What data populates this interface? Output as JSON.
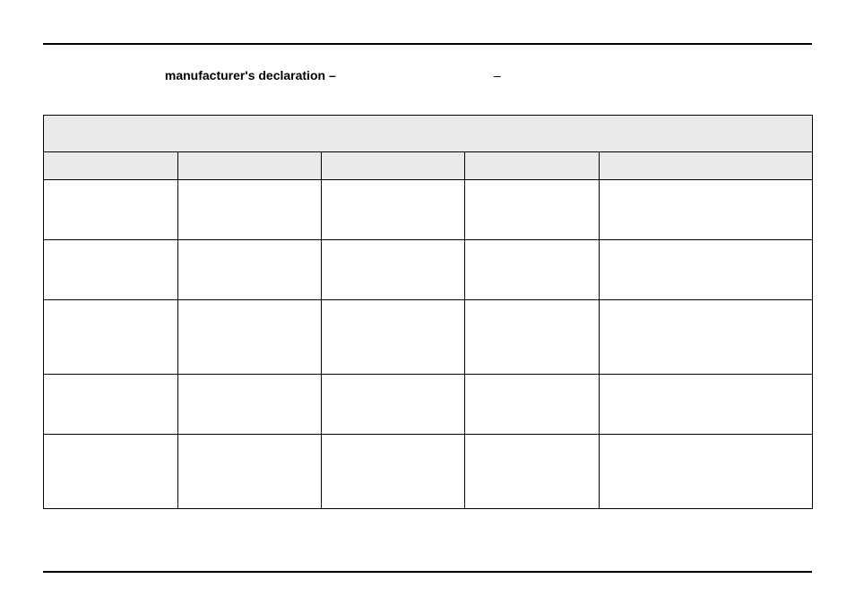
{
  "title": {
    "prefix": "manufacturer's declaration –",
    "mid_gap": "",
    "dash2": "–"
  },
  "table": {
    "header": "",
    "columns": [
      "",
      "",
      "",
      "",
      ""
    ],
    "rows": [
      [
        "",
        "",
        "",
        "",
        ""
      ],
      [
        "",
        "",
        "",
        "",
        ""
      ],
      [
        "",
        "",
        "",
        "",
        ""
      ],
      [
        "",
        "",
        "",
        "",
        ""
      ],
      [
        "",
        "",
        "",
        "",
        ""
      ]
    ]
  }
}
